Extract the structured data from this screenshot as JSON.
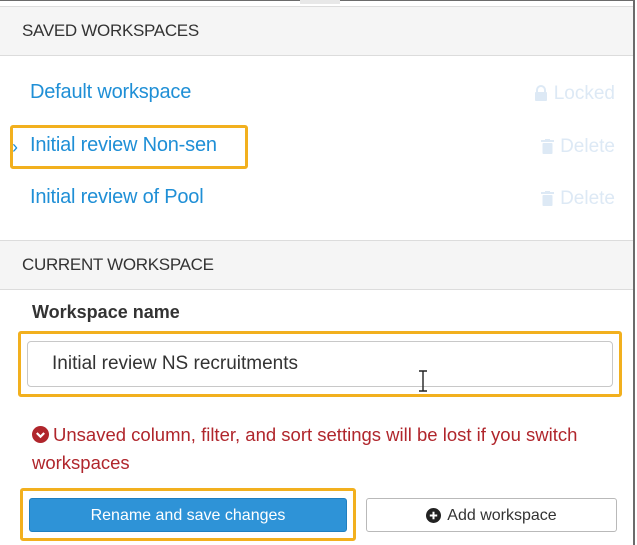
{
  "saved_workspaces": {
    "header": "SAVED WORKSPACES",
    "items": [
      {
        "name": "Default workspace",
        "action_label": "Locked",
        "action_icon": "lock-icon",
        "selected": false
      },
      {
        "name": "Initial review Non-sen",
        "action_label": "Delete",
        "action_icon": "trash-icon",
        "selected": true
      },
      {
        "name": "Initial review of Pool",
        "action_label": "Delete",
        "action_icon": "trash-icon",
        "selected": false
      }
    ]
  },
  "current_workspace": {
    "header": "CURRENT WORKSPACE",
    "name_label": "Workspace name",
    "name_value": "Initial review NS recruitments",
    "warning_text": "Unsaved column, filter, and sort settings will be lost if you switch workspaces",
    "warning_icon": "chevron-down-circle-icon",
    "rename_button_label": "Rename and save changes",
    "add_button_label": "Add workspace",
    "add_button_icon": "plus-circle-icon"
  },
  "colors": {
    "accent": "#2e93d7",
    "link": "#1f8fd6",
    "highlight": "#f2b01e",
    "warning": "#b0262c"
  }
}
